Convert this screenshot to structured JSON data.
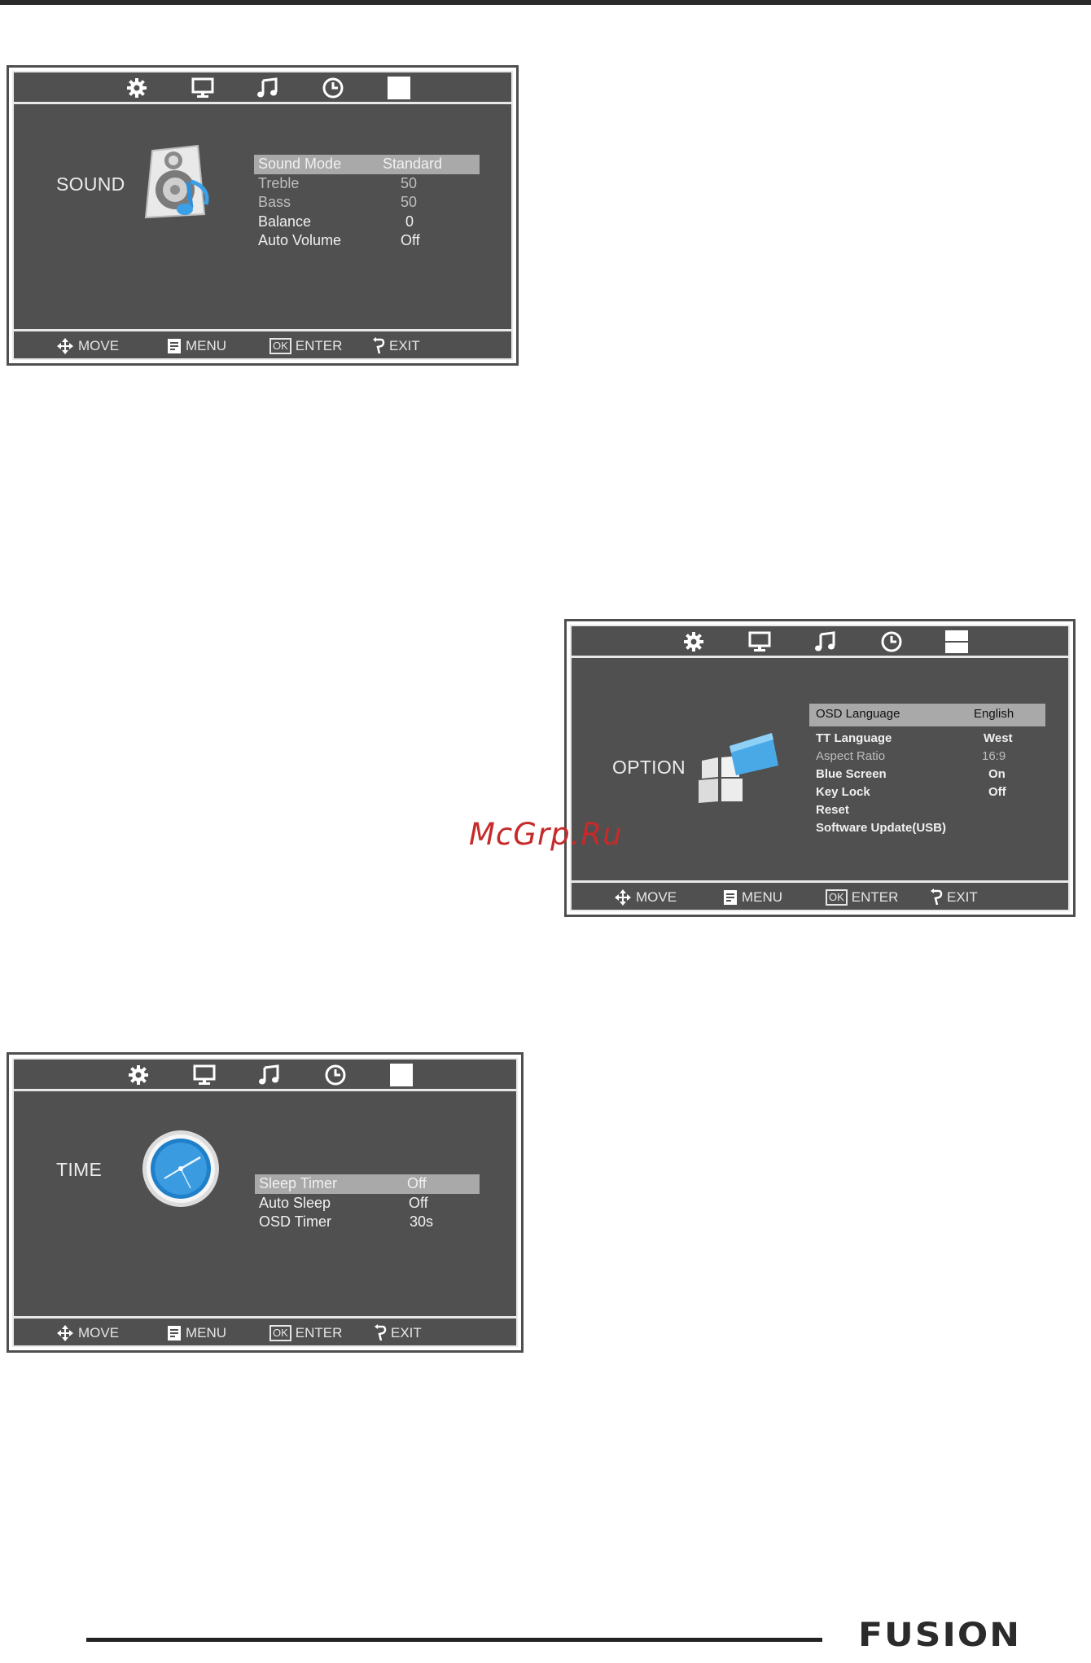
{
  "panels": {
    "sound": {
      "title": "SOUND",
      "tabs": [
        "gear-icon",
        "monitor-icon",
        "music-note-icon",
        "clock-icon",
        "option-square-icon"
      ],
      "rows": [
        {
          "label": "Sound  Mode",
          "value": "Standard",
          "selected": true
        },
        {
          "label": "Treble",
          "value": "50",
          "dim": true
        },
        {
          "label": "Bass",
          "value": "50",
          "dim": true
        },
        {
          "label": "Balance",
          "value": "0"
        },
        {
          "label": "Auto  Volume",
          "value": "Off"
        }
      ],
      "footer": {
        "move": "MOVE",
        "menu": "MENU",
        "ok": "OK",
        "enter": "ENTER",
        "exit": "EXIT"
      }
    },
    "option": {
      "title": "OPTION",
      "tabs": [
        "gear-icon",
        "monitor-icon",
        "music-note-icon",
        "clock-icon",
        "option-square-icon"
      ],
      "rows": [
        {
          "label": "OSD Language",
          "value": "English",
          "selected": true
        },
        {
          "label": "TT Language",
          "value": "West"
        },
        {
          "label": "Aspect Ratio",
          "value": "16:9",
          "dim": true
        },
        {
          "label": "Blue Screen",
          "value": "On"
        },
        {
          "label": "Key Lock",
          "value": "Off"
        },
        {
          "label": "Reset",
          "value": ""
        },
        {
          "label": "Software Update(USB)",
          "value": ""
        }
      ],
      "footer": {
        "move": "MOVE",
        "menu": "MENU",
        "ok": "OK",
        "enter": "ENTER",
        "exit": "EXIT"
      }
    },
    "time": {
      "title": "TIME",
      "tabs": [
        "gear-icon",
        "monitor-icon",
        "music-note-icon",
        "clock-icon",
        "option-square-icon"
      ],
      "rows": [
        {
          "label": "Sleep Timer",
          "value": "Off",
          "selected": true
        },
        {
          "label": "Auto Sleep",
          "value": "Off"
        },
        {
          "label": "OSD Timer",
          "value": "30s"
        }
      ],
      "footer": {
        "move": "MOVE",
        "menu": "MENU",
        "ok": "OK",
        "enter": "ENTER",
        "exit": "EXIT"
      }
    }
  },
  "watermark": "McGrp.Ru",
  "brand": "FUSION",
  "colors": {
    "osd_bg": "#505050",
    "highlight": "#a9a9a9",
    "frame": "#e8e8e8",
    "accent_blue": "#2f8fd6",
    "watermark": "#c62a2a"
  }
}
